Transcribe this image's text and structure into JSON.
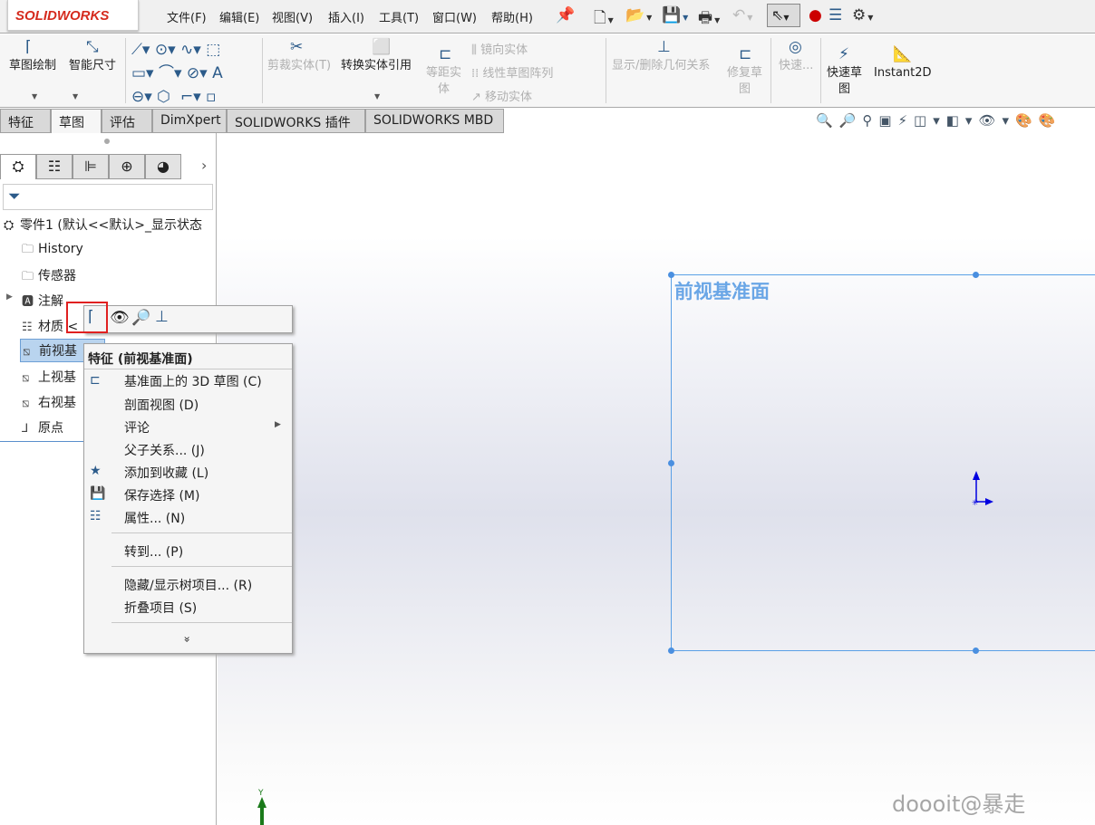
{
  "app": {
    "logo": "SOLIDWORKS"
  },
  "menubar": [
    "文件(F)",
    "编辑(E)",
    "视图(V)",
    "插入(I)",
    "工具(T)",
    "窗口(W)",
    "帮助(H)"
  ],
  "ribbon": {
    "sketch": "草图绘制",
    "smart_dim": "智能尺寸",
    "trim": "剪裁实体(T)",
    "convert": "转换实体引用",
    "offset_1": "等距实",
    "offset_2": "体",
    "mirror": "镜向实体",
    "linear_pattern": "线性草图阵列",
    "move": "移动实体",
    "relations": "显示/删除几何关系",
    "repair_1": "修复草",
    "repair_2": "图",
    "quick": "快速...",
    "quick_sketch_1": "快速草",
    "quick_sketch_2": "图",
    "instant2d": "Instant2D"
  },
  "tabs": [
    "特征",
    "草图",
    "评估",
    "DimXpert",
    "SOLIDWORKS 插件",
    "SOLIDWORKS MBD"
  ],
  "tree": {
    "root": "零件1  (默认<<默认>_显示状态",
    "items": [
      "History",
      "传感器",
      "注解",
      "材质 <",
      "前视基",
      "上视基",
      "右视基",
      "原点"
    ]
  },
  "context_menu": {
    "title": "特征 (前视基准面)",
    "items": [
      "基准面上的 3D 草图 (C)",
      "剖面视图 (D)",
      "评论",
      "父子关系... (J)",
      "添加到收藏 (L)",
      "保存选择 (M)",
      "属性... (N)",
      "转到... (P)",
      "隐藏/显示树项目... (R)",
      "折叠项目 (S)"
    ],
    "more": "»"
  },
  "canvas": {
    "plane_label": "前视基准面",
    "axis_y": "Y",
    "watermark": "doooit@暴走"
  },
  "colors": {
    "accent": "#5aa0e6",
    "logo": "#d52b1e",
    "highlight_box": "#e02020"
  }
}
